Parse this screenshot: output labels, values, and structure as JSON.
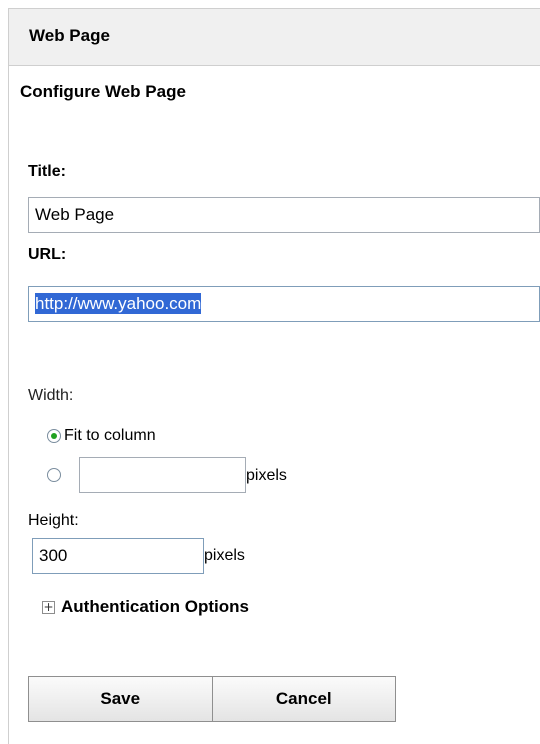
{
  "header": {
    "title": "Web Page"
  },
  "subtitle": "Configure Web Page",
  "form": {
    "title_label": "Title:",
    "title_value": "Web Page",
    "url_label": "URL:",
    "url_value": "http://www.yahoo.com",
    "width_label": "Width:",
    "width_options": [
      {
        "label": "Fit to column",
        "selected": true
      },
      {
        "label": "",
        "selected": false
      }
    ],
    "width_custom_value": "",
    "width_unit": "pixels",
    "height_label": "Height:",
    "height_value": "300",
    "height_unit": "pixels",
    "auth_toggle_symbol": "+",
    "auth_label": "Authentication Options"
  },
  "buttons": {
    "save": "Save",
    "cancel": "Cancel"
  },
  "colors": {
    "header_bg": "#f0f0f0",
    "selection": "#3168d5",
    "radio_checked": "#21a121"
  }
}
